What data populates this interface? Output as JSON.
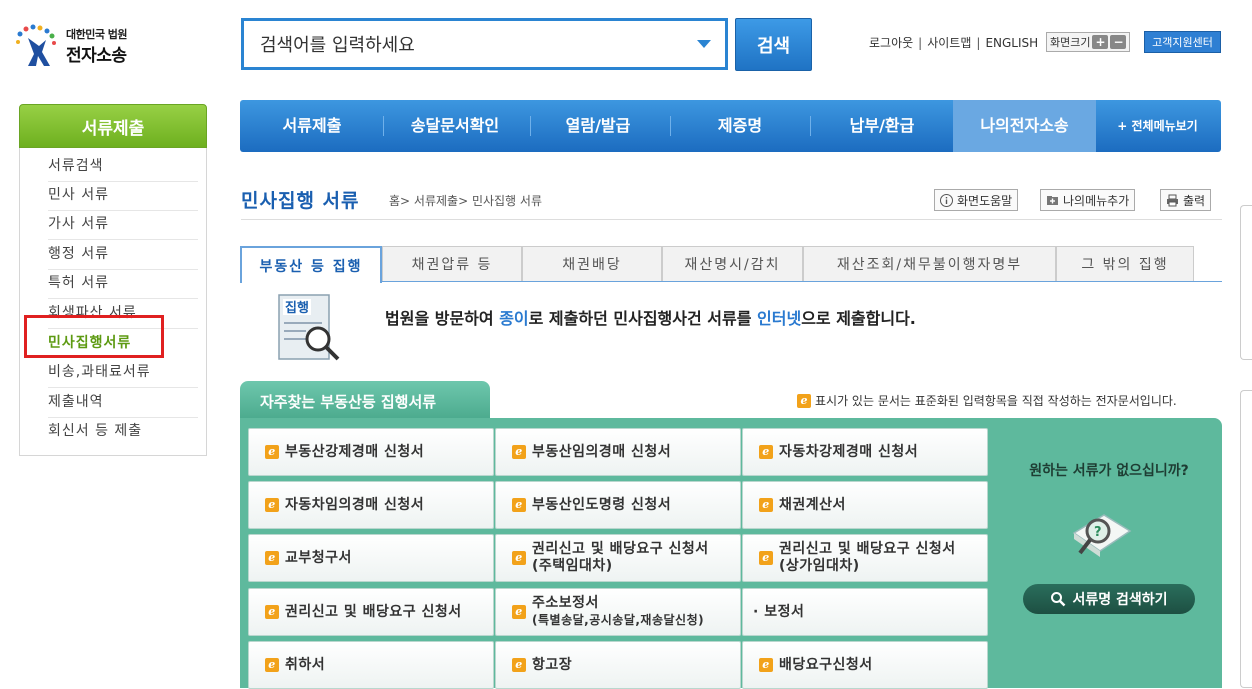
{
  "header": {
    "logo_line1": "대한민국 법원",
    "logo_line2": "전자소송",
    "search_placeholder": "검색어를 입력하세요",
    "search_button": "검색",
    "links": [
      "로그아웃",
      "사이트맵",
      "ENGLISH"
    ],
    "zoom_label": "화면크기",
    "zoom_in": "+",
    "zoom_out": "−",
    "customer_center": "고객지원센터"
  },
  "sidebar": {
    "title": "서류제출",
    "items": [
      {
        "label": "서류검색"
      },
      {
        "label": "민사 서류"
      },
      {
        "label": "가사 서류"
      },
      {
        "label": "행정 서류"
      },
      {
        "label": "특허 서류"
      },
      {
        "label": "회생파산 서류"
      },
      {
        "label": "민사집행서류",
        "active": true
      },
      {
        "label": "비송,과태료서류"
      },
      {
        "label": "제출내역"
      },
      {
        "label": "회신서 등 제출"
      }
    ]
  },
  "gnb": {
    "items": [
      "서류제출",
      "송달문서확인",
      "열람/발급",
      "제증명",
      "납부/환급",
      "나의전자소송"
    ],
    "current": "나의전자소송",
    "all_menu": "+ 전체메뉴보기"
  },
  "page": {
    "title": "민사집행 서류",
    "breadcrumb": "홈> 서류제출> 민사집행 서류",
    "tools": [
      "화면도움말",
      "나의메뉴추가",
      "출력"
    ]
  },
  "tabs": [
    "부동산 등 집행",
    "채권압류 등",
    "채권배당",
    "재산명시/감치",
    "재산조회/채무불이행자명부",
    "그 밖의 집행"
  ],
  "active_tab": "부동산 등 집행",
  "intro": {
    "icon_label": "집행",
    "text_part1": "법원을 방문하여 ",
    "text_hl1": "종이",
    "text_part2": "로 제출하던 민사집행사건 서류를 ",
    "text_hl2": "인터넷",
    "text_part3": "으로 제출합니다."
  },
  "favorites": {
    "title": "자주찾는 부동산등 집행서류",
    "note": "표시가 있는 문서는 표준화된 입력항목을 직접 작성하는 전자문서입니다.",
    "docs": [
      {
        "l1": "부동산강제경매 신청서",
        "l2": "",
        "e": true
      },
      {
        "l1": "부동산임의경매 신청서",
        "l2": "",
        "e": true
      },
      {
        "l1": "자동차강제경매 신청서",
        "l2": "",
        "e": true
      },
      {
        "l1": "자동차임의경매 신청서",
        "l2": "",
        "e": true
      },
      {
        "l1": "부동산인도명령 신청서",
        "l2": "",
        "e": true
      },
      {
        "l1": "채권계산서",
        "l2": "",
        "e": true
      },
      {
        "l1": "교부청구서",
        "l2": "",
        "e": true
      },
      {
        "l1": "권리신고 및 배당요구 신청서",
        "l2": "(주택임대차)",
        "e": true
      },
      {
        "l1": "권리신고 및 배당요구 신청서",
        "l2": "(상가임대차)",
        "e": true
      },
      {
        "l1": "권리신고 및 배당요구 신청서",
        "l2": "",
        "e": true
      },
      {
        "l1": "주소보정서",
        "l2": "(특별송달,공시송달,재송달신청)",
        "e": true
      },
      {
        "l1": "· 보정서",
        "l2": "",
        "e": false
      },
      {
        "l1": "취하서",
        "l2": "",
        "e": true
      },
      {
        "l1": "항고장",
        "l2": "",
        "e": true
      },
      {
        "l1": "배당요구신청서",
        "l2": "",
        "e": true
      }
    ],
    "no_result_question": "원하는 서류가 없으십니까?",
    "find_button": "서류명 검색하기"
  },
  "colors": {
    "brand_blue": "#1c6cc0",
    "sidebar_green": "#6eb01f",
    "panel_teal": "#5eb99d",
    "highlight_red": "#e02020"
  }
}
